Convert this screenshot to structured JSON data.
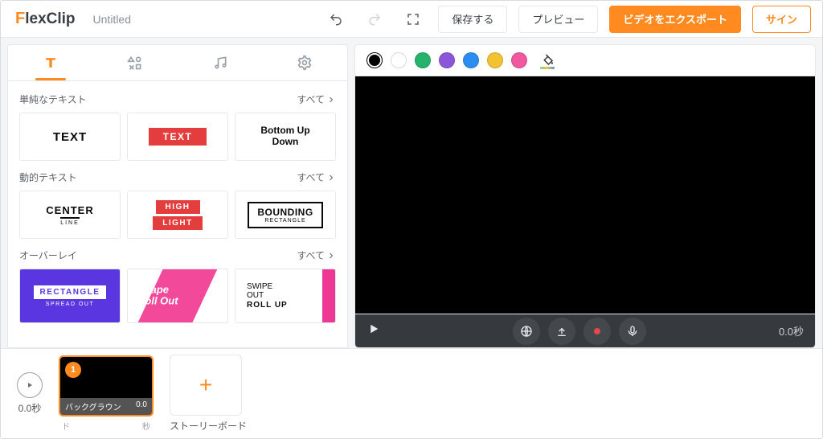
{
  "brand": {
    "initial": "F",
    "rest": "lexClip"
  },
  "project_title": "Untitled",
  "header": {
    "save": "保存する",
    "preview": "プレビュー",
    "export": "ビデオをエクスポート",
    "sign": "サイン"
  },
  "swatches": [
    "#000000",
    "#ffffff",
    "#25b36b",
    "#8b57d8",
    "#2a8ef0",
    "#f2c233",
    "#f0589f"
  ],
  "left": {
    "all_label": "すべて",
    "sections": {
      "simple": {
        "title": "単純なテキスト",
        "cards": [
          "TEXT",
          "TEXT",
          "Bottom Up\nDown"
        ]
      },
      "dynamic": {
        "title": "動的テキスト",
        "center": {
          "big": "CENTER",
          "sub": "LINE"
        },
        "high": {
          "top": "HIGH",
          "bot": "LIGHT"
        },
        "bound": {
          "big": "BOUNDING",
          "sub": "RECTANGLE"
        }
      },
      "overlay": {
        "title": "オーバーレイ",
        "rect": {
          "big": "RECTANGLE",
          "sub": "SPREAD OUT"
        },
        "shape": {
          "l1": "Shape",
          "l2": "Roll Out"
        },
        "swipe": {
          "l1": "SWIPE",
          "l2": "OUT",
          "l3": "ROLL UP"
        }
      }
    }
  },
  "player": {
    "time": "0.0秒"
  },
  "timeline": {
    "duration": "0.0秒",
    "clip": {
      "index": "1",
      "name": "バックグラウン",
      "length": "0.0"
    },
    "clip_sub": {
      "left": "ド",
      "right": "秒"
    },
    "add_label": "ストーリーボード"
  }
}
